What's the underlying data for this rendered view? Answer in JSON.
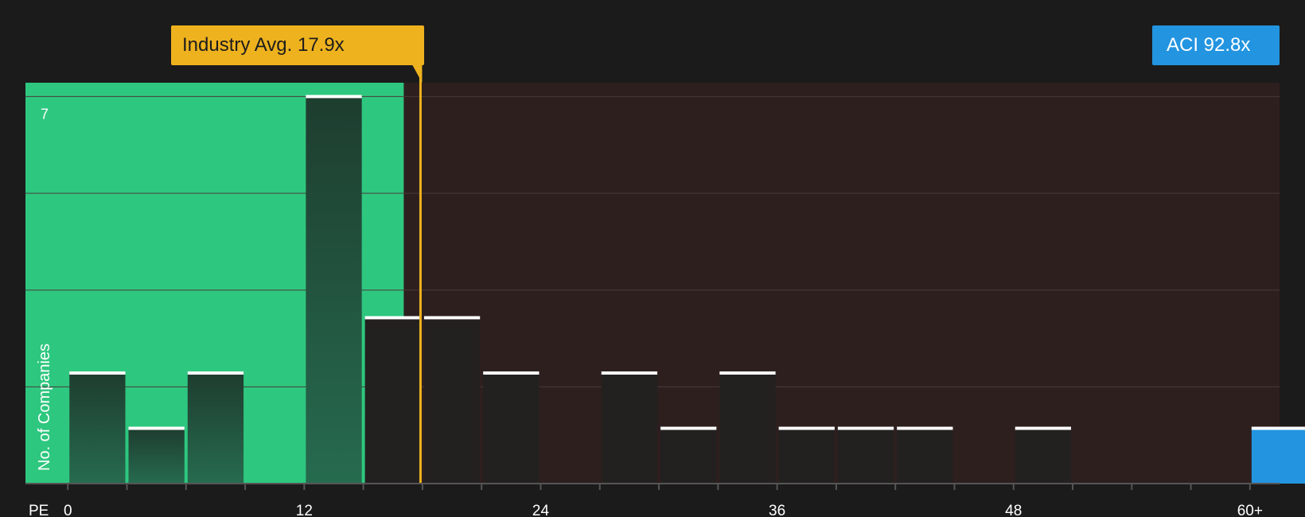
{
  "chart_data": {
    "type": "bar",
    "ylabel": "No. of Companies",
    "xlabel": "PE",
    "y_tick_label": "7",
    "ylim": [
      0,
      7.25
    ],
    "x_ticks": [
      "0",
      "12",
      "24",
      "36",
      "48",
      "60+"
    ],
    "x_tick_values": [
      0,
      12,
      24,
      36,
      48,
      60
    ],
    "xlim": [
      -2.15,
      61.5
    ],
    "grid": true,
    "bin_width": 3,
    "bars": [
      {
        "x": 0,
        "value": 2
      },
      {
        "x": 3,
        "value": 1
      },
      {
        "x": 6,
        "value": 2
      },
      {
        "x": 12,
        "value": 7
      },
      {
        "x": 15,
        "value": 3
      },
      {
        "x": 18,
        "value": 3
      },
      {
        "x": 21,
        "value": 2
      },
      {
        "x": 27,
        "value": 2
      },
      {
        "x": 30,
        "value": 1
      },
      {
        "x": 33,
        "value": 2
      },
      {
        "x": 36,
        "value": 1
      },
      {
        "x": 39,
        "value": 1
      },
      {
        "x": 42,
        "value": 1
      },
      {
        "x": 48,
        "value": 1
      },
      {
        "x": 60,
        "value": 1,
        "highlight": true
      }
    ],
    "industry_avg": {
      "label": "Industry Avg. 17.9x",
      "value": 17.9
    },
    "company": {
      "label": "ACI 92.8x",
      "value": 92.8
    },
    "colors": {
      "background": "#1b1b1b",
      "below_avg_region": "#2ec77f",
      "above_avg_region": "#2e1f1f",
      "bar_below": "#1e3d2f",
      "bar_above": "#232020",
      "company_bar": "#2394e0",
      "industry_line": "#eeb21e",
      "bar_cap": "#ffffff",
      "grid": "#4a3b3b"
    }
  }
}
